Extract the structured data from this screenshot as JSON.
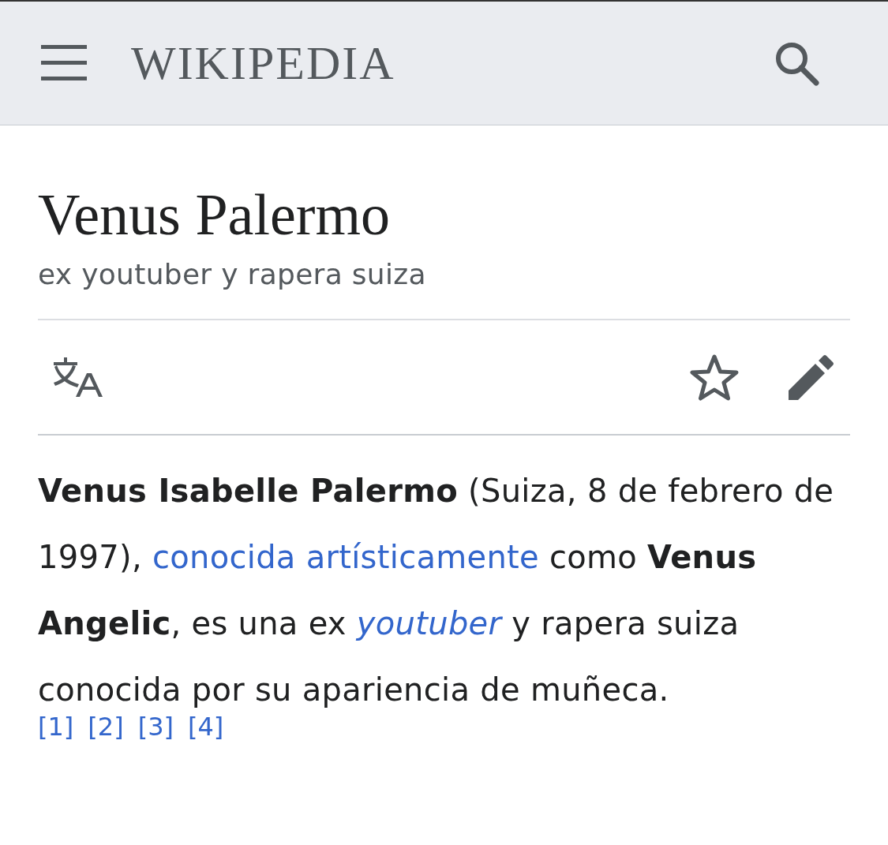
{
  "header": {
    "logo": "WIKIPEDIA"
  },
  "article": {
    "title": "Venus Palermo",
    "description": "ex youtuber y rapera suiza"
  },
  "paragraph": [
    {
      "kind": "text",
      "text": "**Venus Isabelle Palermo** (Suiza, 8 de febrero de 1997), "
    },
    {
      "kind": "link",
      "text": "conocida artísticamente",
      "italic": false
    },
    {
      "kind": "text",
      "text": " como **Venus Angelic**, es una ex "
    },
    {
      "kind": "link",
      "text": "youtuber",
      "italic": true
    },
    {
      "kind": "text",
      "text": " y rapera suiza conocida por su apariencia de muñeca."
    }
  ],
  "references": [
    "[1]",
    "[2]",
    "[3]",
    "[4]"
  ]
}
